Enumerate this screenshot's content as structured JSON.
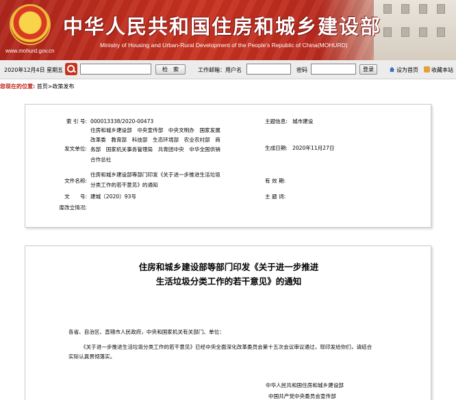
{
  "header": {
    "title_cn": "中华人民共和国住房和城乡建设部",
    "title_en": "Ministry of Housing and Urban-Rural Development of the People's Republic of China(MOHURD)",
    "url": "www.mohurd.gov.cn",
    "emblem_icon": "national-emblem-icon",
    "colors": {
      "banner_red": "#c8321f"
    }
  },
  "toolbar": {
    "date": "2020年12月4日 星期五",
    "search_value": "",
    "search_button": "检　索",
    "work_email_label": "工作邮箱：用户名",
    "username_value": "",
    "password_label": "密码",
    "password_value": "",
    "login_button": "登录",
    "set_home": "设为首页",
    "bookmark": "收藏本站"
  },
  "breadcrumb": {
    "label": "您现在的位置:",
    "home": "首页",
    "separator": ">",
    "current": "政策发布"
  },
  "info": {
    "index_label": "索 引 号:",
    "index_value": "000013338/2020-00473",
    "category_label": "主题信息:",
    "category_value": "城市建设",
    "issuer_label": "发文单位:",
    "issuer_lines": [
      "住房和城乡建设部　中央宣传部　中央文明办　国家发展",
      "改革委　教育部　科技部　生态环境部　农业农村部　商",
      "务部　国家机关事务管理局　共青团中央　中华全国供销",
      "合作总社"
    ],
    "date_label": "生成日期:",
    "date_value": "2020年11月27日",
    "filename_label": "文件名称:",
    "filename_lines": [
      "住房和城乡建设部等部门印发《关于进一步推进生活垃圾",
      "分类工作的若干意见》的通知"
    ],
    "valid_label": "有 效 期:",
    "valid_value": "",
    "docno_label": "文　　号:",
    "docno_value": "建城〔2020〕93号",
    "keywords_label": "主 题 词:",
    "keywords_value": "",
    "revision_label": "废改立情况:",
    "revision_value": ""
  },
  "article": {
    "title_lines": [
      "住房和城乡建设部等部门印发《关于进一步推进",
      "生活垃圾分类工作的若干意见》的通知"
    ],
    "salutation": "各省、自治区、直辖市人民政府，中央和国家机关有关部门、单位：",
    "body_lines": [
      "《关于进一步推进生活垃圾分类工作的若干意见》已经中央全面深化改革委员会第十五次会议审议通过，现印发给你们，请结合",
      "实际认真贯彻落实。"
    ],
    "signatures": [
      "中华人民共和国住房和城乡建设部",
      "中国共产党中央委员会宣传部"
    ]
  }
}
